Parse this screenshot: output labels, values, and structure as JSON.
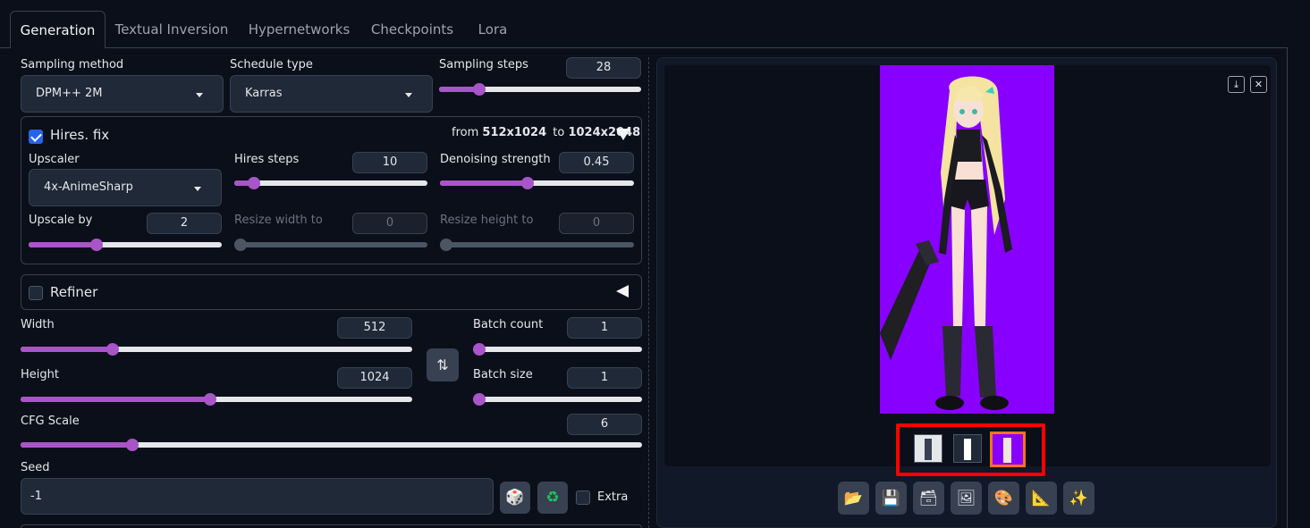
{
  "tabs": [
    "Generation",
    "Textual Inversion",
    "Hypernetworks",
    "Checkpoints",
    "Lora"
  ],
  "active_tab": "Generation",
  "sampling": {
    "method_label": "Sampling method",
    "method_value": "DPM++ 2M",
    "schedule_label": "Schedule type",
    "schedule_value": "Karras",
    "steps_label": "Sampling steps",
    "steps_value": "28",
    "steps_fraction": 0.2
  },
  "hires": {
    "label": "Hires. fix",
    "checked": true,
    "info_from": "from",
    "info_src": "512x1024",
    "info_to": "to",
    "info_dst": "1024x2048",
    "upscaler_label": "Upscaler",
    "upscaler_value": "4x-AnimeSharp",
    "steps_label": "Hires steps",
    "steps_value": "10",
    "steps_fraction": 0.1,
    "denoise_label": "Denoising strength",
    "denoise_value": "0.45",
    "denoise_fraction": 0.45,
    "upscale_label": "Upscale by",
    "upscale_value": "2",
    "upscale_fraction": 0.35,
    "resize_w_label": "Resize width to",
    "resize_w_value": "0",
    "resize_h_label": "Resize height to",
    "resize_h_value": "0"
  },
  "refiner": {
    "label": "Refiner",
    "checked": false
  },
  "dims": {
    "width_label": "Width",
    "width_value": "512",
    "width_fraction": 0.235,
    "height_label": "Height",
    "height_value": "1024",
    "height_fraction": 0.485,
    "swap_icon": "⇅",
    "batch_count_label": "Batch count",
    "batch_count_value": "1",
    "batch_size_label": "Batch size",
    "batch_size_value": "1"
  },
  "cfg": {
    "label": "CFG Scale",
    "value": "6",
    "fraction": 0.18
  },
  "seed": {
    "label": "Seed",
    "value": "-1",
    "dice_icon": "🎲",
    "recycle_icon": "♻",
    "extra_label": "Extra"
  },
  "gallery": {
    "download_icon": "⤓",
    "close_icon": "✕",
    "toolbar_icons": [
      "📂",
      "💾",
      "🗃",
      "🖼",
      "🎨",
      "📐",
      "✨"
    ],
    "highlight_color": "#ff0000",
    "selected_thumb_color": "#f97316",
    "image_bg": "#8800ff"
  }
}
